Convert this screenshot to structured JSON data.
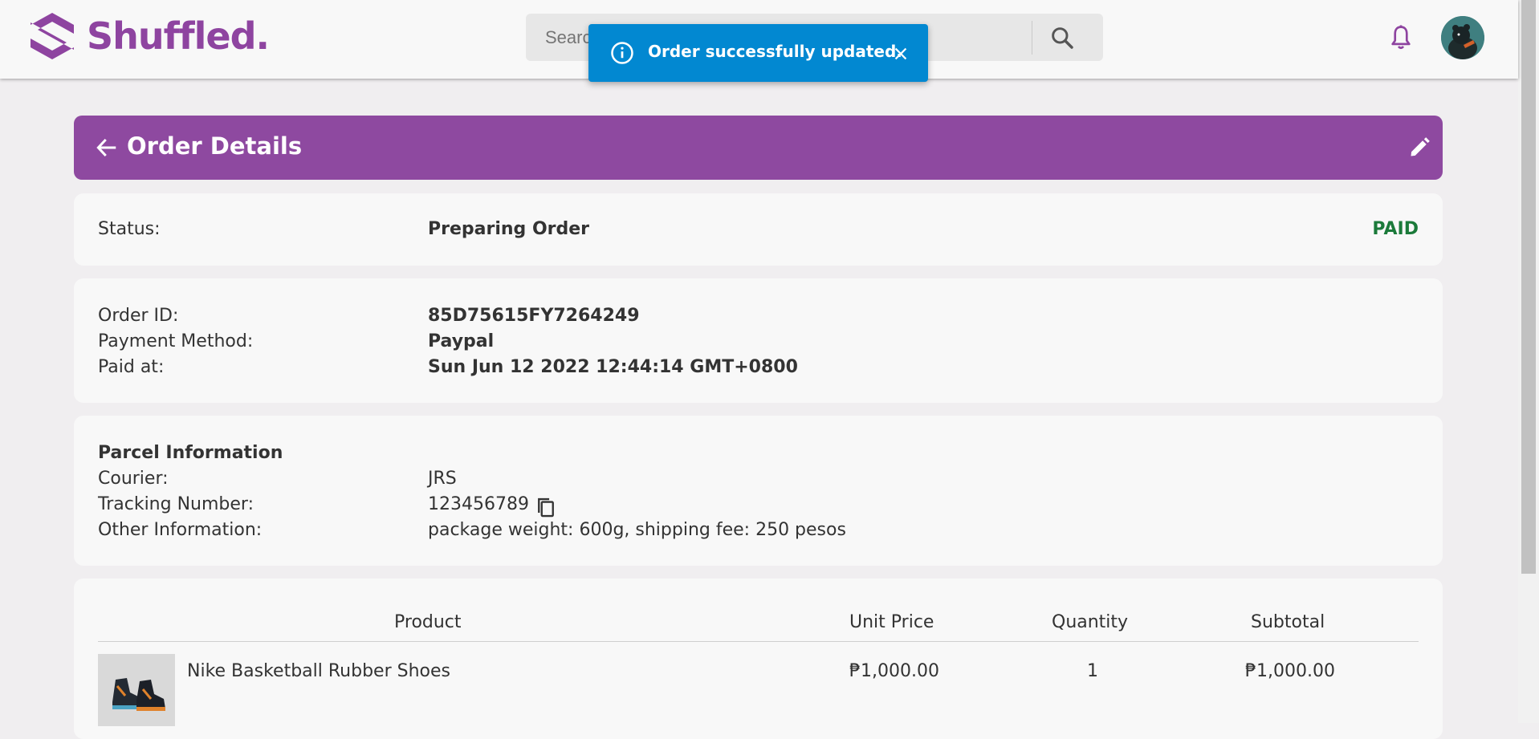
{
  "header": {
    "brand": "Shuffled.",
    "search_placeholder": "Search",
    "icons": [
      "logo-icon",
      "search-icon",
      "bell-icon",
      "avatar"
    ]
  },
  "toast": {
    "message": "Order successfully updated.",
    "icon": "info-icon",
    "color": "#0288d1"
  },
  "order": {
    "title": "Order Details",
    "status_label": "Status:",
    "status_value": "Preparing Order",
    "payment_status": "PAID",
    "order_id_label": "Order ID:",
    "order_id": "85D75615FY7264249",
    "payment_method_label": "Payment Method:",
    "payment_method": "Paypal",
    "paid_at_label": "Paid at:",
    "paid_at": "Sun Jun 12 2022 12:44:14 GMT+0800"
  },
  "parcel": {
    "heading": "Parcel Information",
    "courier_label": "Courier:",
    "courier": "JRS",
    "tracking_label": "Tracking Number:",
    "tracking": "123456789",
    "other_label": "Other Information:",
    "other": "package weight: 600g, shipping fee: 250 pesos"
  },
  "products": {
    "columns": [
      "Product",
      "Unit Price",
      "Quantity",
      "Subtotal"
    ],
    "rows": [
      {
        "name": "Nike Basketball Rubber Shoes",
        "unit_price": "₱1,000.00",
        "quantity": "1",
        "subtotal": "₱1,000.00"
      }
    ]
  },
  "colors": {
    "brand": "#8e44a0",
    "title_bar": "#8e49a0",
    "paid": "#1b7a3a"
  }
}
